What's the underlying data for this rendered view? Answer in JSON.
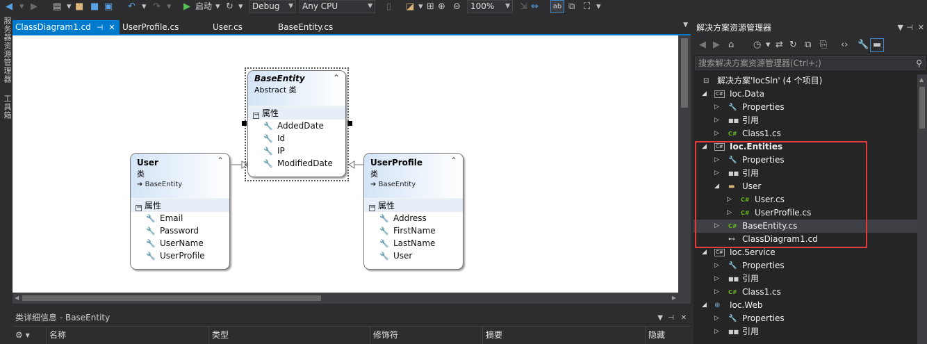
{
  "toolbar": {
    "start_label": "启动",
    "config": "Debug",
    "platform": "Any CPU",
    "zoom": "100%"
  },
  "left_strip": {
    "item1": "服务器资源管理器",
    "item2": "工具箱"
  },
  "doc_tabs": [
    {
      "label": "ClassDiagram1.cd",
      "active": true
    },
    {
      "label": "UserProfile.cs",
      "active": false
    },
    {
      "label": "User.cs",
      "active": false
    },
    {
      "label": "BaseEntity.cs",
      "active": false
    }
  ],
  "diagram": {
    "base": {
      "name": "BaseEntity",
      "kind": "Abstract 类",
      "section": "属性",
      "properties": [
        "AddedDate",
        "Id",
        "IP",
        "ModifiedDate"
      ]
    },
    "user": {
      "name": "User",
      "kind": "类",
      "base": "BaseEntity",
      "section": "属性",
      "properties": [
        "Email",
        "Password",
        "UserName",
        "UserProfile"
      ]
    },
    "profile": {
      "name": "UserProfile",
      "kind": "类",
      "base": "BaseEntity",
      "section": "属性",
      "properties": [
        "Address",
        "FirstName",
        "LastName",
        "User"
      ]
    }
  },
  "details": {
    "title": "类详细信息 - BaseEntity",
    "columns": [
      "名称",
      "类型",
      "修饰符",
      "摘要",
      "隐藏"
    ]
  },
  "solution_explorer": {
    "title": "解决方案资源管理器",
    "search_placeholder": "搜索解决方案资源管理器(Ctrl+;)",
    "highlight_color": "#e33b3b",
    "tree": [
      {
        "label": "解决方案'IocSln' (4 个项目)",
        "icon": "solution-icon"
      },
      {
        "label": "Ioc.Data",
        "icon": "csharp-project-icon",
        "expanded": true
      },
      {
        "label": "Properties",
        "icon": "wrench-icon"
      },
      {
        "label": "引用",
        "icon": "references-icon"
      },
      {
        "label": "Class1.cs",
        "icon": "csharp-file-icon"
      },
      {
        "label": "Ioc.Entities",
        "icon": "csharp-project-icon",
        "expanded": true,
        "bold": true
      },
      {
        "label": "Properties",
        "icon": "wrench-icon"
      },
      {
        "label": "引用",
        "icon": "references-icon"
      },
      {
        "label": "User",
        "icon": "folder-icon",
        "expanded": true
      },
      {
        "label": "User.cs",
        "icon": "csharp-file-icon"
      },
      {
        "label": "UserProfile.cs",
        "icon": "csharp-file-icon"
      },
      {
        "label": "BaseEntity.cs",
        "icon": "csharp-file-icon",
        "selected": true
      },
      {
        "label": "ClassDiagram1.cd",
        "icon": "class-diagram-icon"
      },
      {
        "label": "Ioc.Service",
        "icon": "csharp-project-icon",
        "expanded": true
      },
      {
        "label": "Properties",
        "icon": "wrench-icon"
      },
      {
        "label": "引用",
        "icon": "references-icon"
      },
      {
        "label": "Class1.cs",
        "icon": "csharp-file-icon"
      },
      {
        "label": "Ioc.Web",
        "icon": "web-project-icon",
        "expanded": true
      },
      {
        "label": "Properties",
        "icon": "wrench-icon"
      },
      {
        "label": "引用",
        "icon": "references-icon"
      }
    ]
  }
}
